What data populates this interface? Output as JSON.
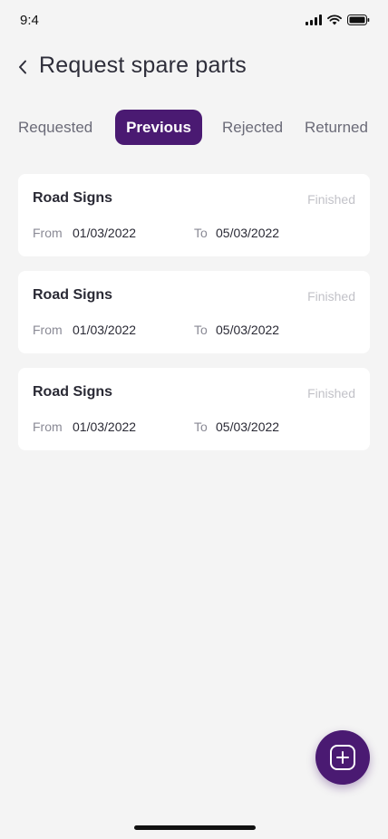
{
  "status_bar": {
    "time": "9:4"
  },
  "header": {
    "title": "Request spare parts"
  },
  "tabs": [
    {
      "label": "Requested"
    },
    {
      "label": "Previous"
    },
    {
      "label": "Rejected"
    },
    {
      "label": "Returned"
    }
  ],
  "cards": [
    {
      "title": "Road Signs",
      "status": "Finished",
      "from_label": "From",
      "from_date": "01/03/2022",
      "to_label": "To",
      "to_date": "05/03/2022"
    },
    {
      "title": "Road Signs",
      "status": "Finished",
      "from_label": "From",
      "from_date": "01/03/2022",
      "to_label": "To",
      "to_date": "05/03/2022"
    },
    {
      "title": "Road Signs",
      "status": "Finished",
      "from_label": "From",
      "from_date": "01/03/2022",
      "to_label": "To",
      "to_date": "05/03/2022"
    }
  ],
  "colors": {
    "accent": "#4a1a72",
    "background": "#f4f4f4",
    "card": "#ffffff",
    "status_text": "#c2c2c8"
  },
  "icons": {
    "back": "chevron-left-icon",
    "fab": "add-square-icon"
  }
}
